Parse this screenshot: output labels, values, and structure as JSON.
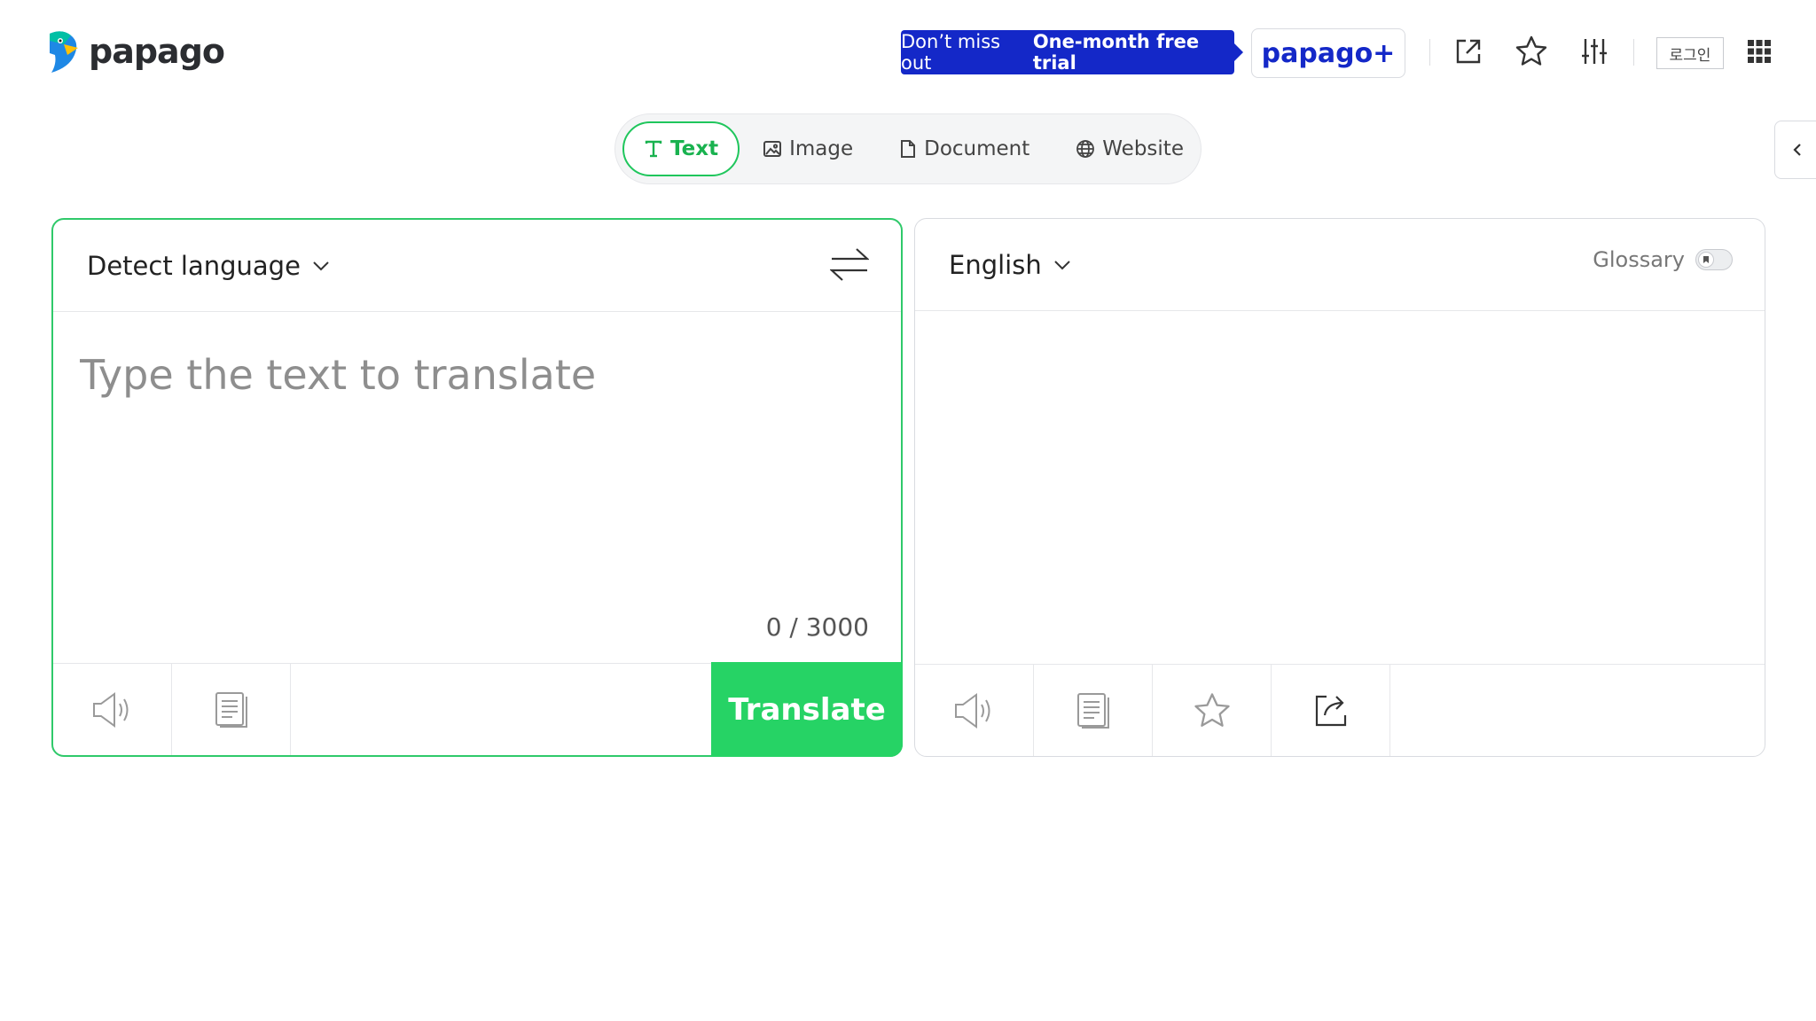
{
  "header": {
    "logo_text": "papago",
    "promo_prefix": "Don’t miss out",
    "promo_highlight": "One-month free trial",
    "plus_label": "papago+",
    "login_label": "로그인"
  },
  "mode_tabs": [
    {
      "label": "Text",
      "icon": "text-icon",
      "active": true
    },
    {
      "label": "Image",
      "icon": "image-icon",
      "active": false
    },
    {
      "label": "Document",
      "icon": "document-icon",
      "active": false
    },
    {
      "label": "Website",
      "icon": "globe-icon",
      "active": false
    }
  ],
  "source": {
    "language": "Detect language",
    "placeholder": "Type the text to translate",
    "value": "",
    "char_count": "0 / 3000",
    "translate_label": "Translate"
  },
  "target": {
    "language": "English",
    "glossary_label": "Glossary",
    "glossary_enabled": false
  },
  "colors": {
    "accent_green": "#26d365",
    "brand_blue": "#1428c8"
  }
}
